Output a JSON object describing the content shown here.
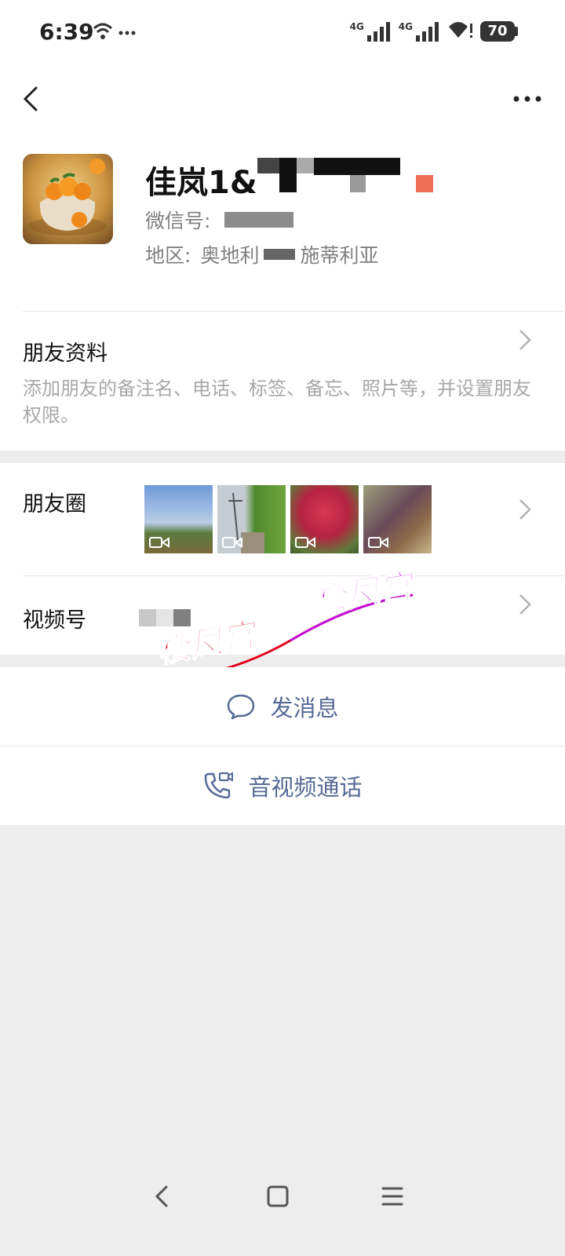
{
  "status_bar": {
    "time": "6:39",
    "network_1": "4G",
    "network_2": "4G",
    "battery": "70"
  },
  "nav": {
    "back_icon": "chevron-left-icon",
    "more_icon": "ellipsis-icon"
  },
  "profile": {
    "name": "佳岚1&",
    "wechat_id_label": "微信号:",
    "region_label": "地区:",
    "region_value_part1": "奥地利",
    "region_value_part2": "施蒂利亚"
  },
  "friend_info": {
    "title": "朋友资料",
    "description": "添加朋友的备注名、电话、标签、备忘、照片等，并设置朋友权限。"
  },
  "moments": {
    "label": "朋友圈",
    "photo_count": 4
  },
  "channels": {
    "label": "视频号"
  },
  "watermark": {
    "text": "楼凤宫"
  },
  "actions": {
    "send_message": "发消息",
    "av_call": "音视频通话"
  },
  "colors": {
    "link_blue": "#576b95",
    "page_bg": "#ededed",
    "watermark_red": "#e3001b",
    "watermark_purple": "#c213d6"
  }
}
